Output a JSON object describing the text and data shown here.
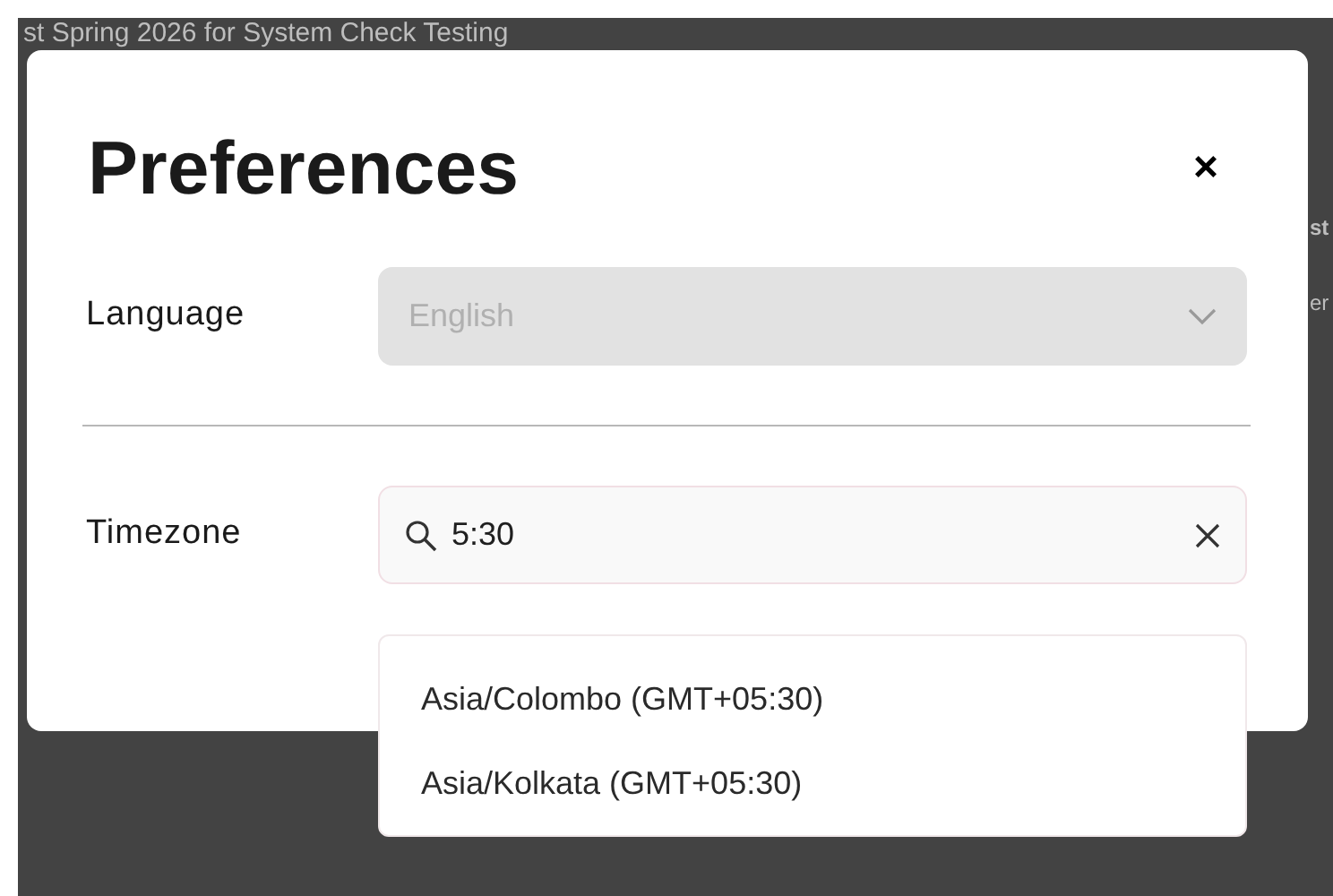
{
  "background": {
    "heading": "st Spring 2026 for System Check Testing",
    "fragments": [
      "st",
      "er"
    ]
  },
  "dialog": {
    "title": "Preferences",
    "close": "×",
    "fields": [
      {
        "label": "Language",
        "kind": "select",
        "value": "English",
        "disabled": true
      },
      {
        "label": "Timezone",
        "kind": "search",
        "value": "5:30",
        "disabled": false
      }
    ],
    "options": [
      {
        "label": "Asia/Colombo (GMT+05:30)",
        "selected": false
      },
      {
        "label": "Asia/Kolkata (GMT+05:30)",
        "selected": false
      }
    ]
  }
}
